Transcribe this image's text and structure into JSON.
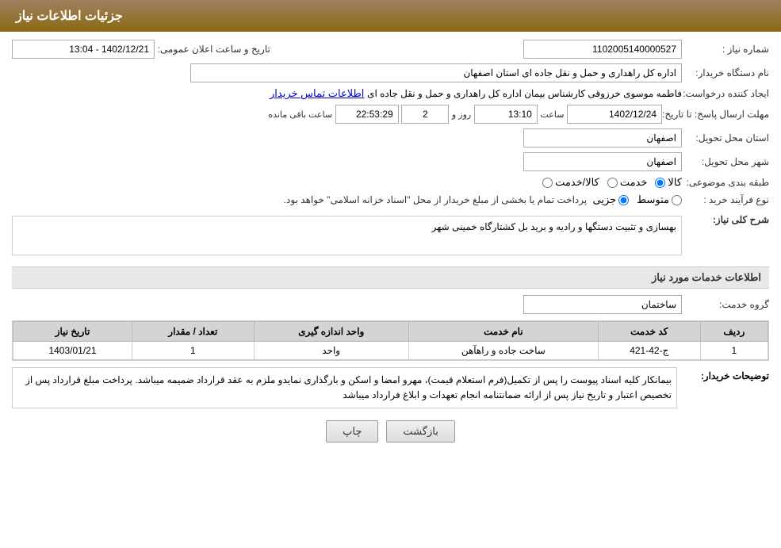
{
  "header": {
    "title": "جزئیات اطلاعات نیاز"
  },
  "fields": {
    "need_number_label": "شماره نیاز :",
    "need_number_value": "1102005140000527",
    "announcement_date_label": "تاریخ و ساعت اعلان عمومی:",
    "announcement_date_value": "1402/12/21 - 13:04",
    "buyer_org_label": "نام دستگاه خریدار:",
    "buyer_org_value": "اداره کل راهداری و حمل و نقل جاده ای استان اصفهان",
    "requester_label": "ایجاد کننده درخواست:",
    "requester_value": "فاطمه موسوی خرزوقی کارشناس بیمان اداره کل راهداری و حمل و نقل جاده ای",
    "contact_link": "اطلاعات تماس خریدار",
    "reply_deadline_label": "مهلت ارسال پاسخ: تا تاریخ:",
    "reply_date": "1402/12/24",
    "reply_time_label": "ساعت",
    "reply_time": "13:10",
    "reply_day_label": "روز و",
    "reply_days": "2",
    "reply_remaining_label": "ساعت باقی مانده",
    "reply_remaining": "22:53:29",
    "province_label": "استان محل تحویل:",
    "province_value": "اصفهان",
    "city_label": "شهر محل تحویل:",
    "city_value": "اصفهان",
    "category_label": "طبقه بندی موضوعی:",
    "category_kala": "کالا",
    "category_khadamat": "خدمت",
    "category_kala_khadamat": "کالا/خدمت",
    "purchase_type_label": "نوع فرآیند خرید :",
    "purchase_type_jazyi": "جزیی",
    "purchase_type_motevaset": "متوسط",
    "purchase_type_note": "پرداخت تمام یا بخشی از مبلغ خریدار از محل \"اسناد خزانه اسلامی\" خواهد بود.",
    "need_description_label": "شرح کلی نیاز:",
    "need_description_value": "بهسازی و تثبیت دستگها و رادیه و برید بل کشتارگاه خمینی شهر",
    "service_info_title": "اطلاعات خدمات مورد نیاز",
    "service_group_label": "گروه خدمت:",
    "service_group_value": "ساختمان",
    "table": {
      "headers": [
        "ردیف",
        "کد خدمت",
        "نام خدمت",
        "واحد اندازه گیری",
        "تعداد / مقدار",
        "تاریخ نیاز"
      ],
      "rows": [
        {
          "row_num": "1",
          "service_code": "ج-42-421",
          "service_name": "ساخت جاده و راهآهن",
          "unit": "واحد",
          "quantity": "1",
          "need_date": "1403/01/21"
        }
      ]
    },
    "buyer_notes_label": "توضیحات خریدار:",
    "buyer_notes_value": "بیمانکار کلیه اسناد پیوست را پس از تکمیل(فرم استعلام قیمت)، مهرو امضا و اسکن و بارگذاری نمایدو ملزم به عقد قرارداد ضمیمه میباشد. پرداخت مبلغ قرارداد پس از تخصیص اعتبار و تاریخ نیاز پس از ارائه ضمانتنامه انجام تعهدات و ابلاغ فرارداد میباشد"
  },
  "buttons": {
    "print": "چاپ",
    "back": "بازگشت"
  }
}
